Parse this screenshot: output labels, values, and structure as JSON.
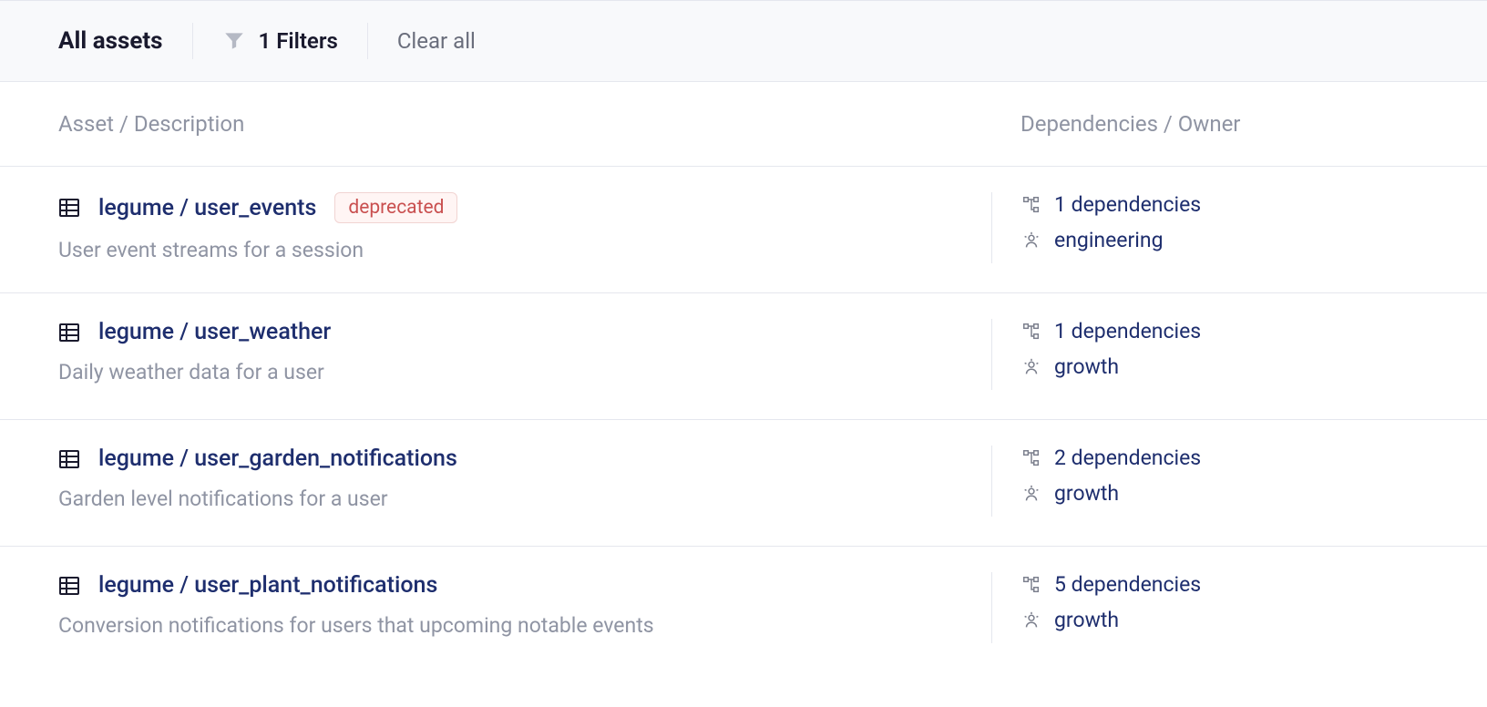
{
  "toolbar": {
    "title": "All assets",
    "filter_label": "1 Filters",
    "clear_label": "Clear all"
  },
  "headers": {
    "asset": "Asset / Description",
    "deps": "Dependencies / Owner"
  },
  "badges": {
    "deprecated": "deprecated"
  },
  "rows": [
    {
      "name": "legume / user_events",
      "deprecated": true,
      "description": "User event streams for a session",
      "dependencies": "1 dependencies",
      "owner": "engineering"
    },
    {
      "name": "legume / user_weather",
      "deprecated": false,
      "description": "Daily weather data for a user",
      "dependencies": "1 dependencies",
      "owner": "growth"
    },
    {
      "name": "legume / user_garden_notifications",
      "deprecated": false,
      "description": "Garden level notifications for a user",
      "dependencies": "2 dependencies",
      "owner": "growth"
    },
    {
      "name": "legume / user_plant_notifications",
      "deprecated": false,
      "description": "Conversion notifications for users that upcoming notable events",
      "dependencies": "5 dependencies",
      "owner": "growth"
    }
  ]
}
